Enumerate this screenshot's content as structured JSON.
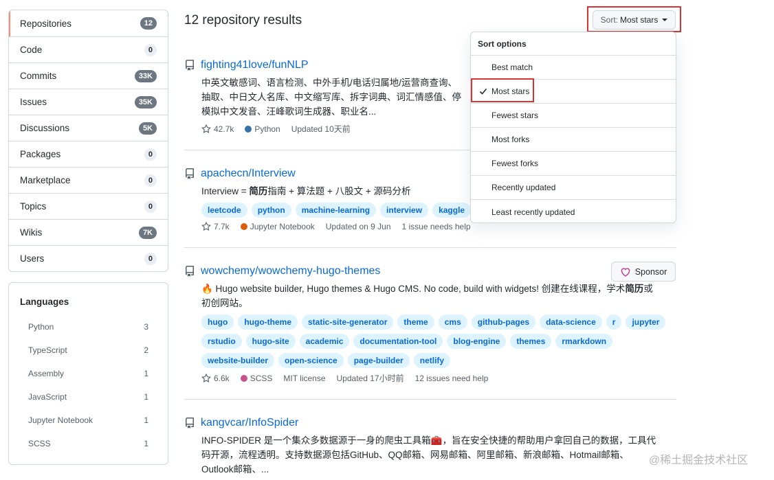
{
  "filters": [
    {
      "label": "Repositories",
      "count": "12",
      "selected": true
    },
    {
      "label": "Code",
      "count": "0"
    },
    {
      "label": "Commits",
      "count": "33K"
    },
    {
      "label": "Issues",
      "count": "35K"
    },
    {
      "label": "Discussions",
      "count": "5K"
    },
    {
      "label": "Packages",
      "count": "0"
    },
    {
      "label": "Marketplace",
      "count": "0"
    },
    {
      "label": "Topics",
      "count": "0"
    },
    {
      "label": "Wikis",
      "count": "7K"
    },
    {
      "label": "Users",
      "count": "0"
    }
  ],
  "languages": {
    "title": "Languages",
    "items": [
      {
        "name": "Python",
        "count": "3"
      },
      {
        "name": "TypeScript",
        "count": "2"
      },
      {
        "name": "Assembly",
        "count": "1"
      },
      {
        "name": "JavaScript",
        "count": "1"
      },
      {
        "name": "Jupyter Notebook",
        "count": "1"
      },
      {
        "name": "SCSS",
        "count": "1"
      }
    ]
  },
  "header": {
    "results_title": "12 repository results",
    "sort_prefix": "Sort: ",
    "sort_value": "Most stars"
  },
  "sort_menu": {
    "title": "Sort options",
    "options": [
      "Best match",
      "Most stars",
      "Fewest stars",
      "Most forks",
      "Fewest forks",
      "Recently updated",
      "Least recently updated"
    ],
    "selected_index": 1
  },
  "repos": [
    {
      "name": "fighting41love/funNLP",
      "desc_lines": [
        "中英文敏感词、语言检测、中外手机/电话归属地/运营商查询、",
        "抽取、中日文人名库、中文缩写库、拆字词典、词汇情感值、停",
        "模拟中文发音、汪峰歌词生成器、职业名..."
      ],
      "stars": "42.7k",
      "language": "Python",
      "language_color": "#3572A5",
      "updated": "Updated 10天前"
    },
    {
      "name": "apachecn/Interview",
      "desc_pre": "Interview = ",
      "desc_bold": "简历",
      "desc_post": "指南 + 算法题 + 八股文 + 源码分析",
      "topics": [
        "leetcode",
        "python",
        "machine-learning",
        "interview",
        "kaggle"
      ],
      "stars": "7.7k",
      "language": "Jupyter Notebook",
      "language_color": "#DA5B0B",
      "updated": "Updated on 9 Jun",
      "issues": "1 issue needs help"
    },
    {
      "name": "wowchemy/wowchemy-hugo-themes",
      "desc_pre": "🔥 Hugo website builder, Hugo themes & Hugo CMS. No code, build with widgets! 创建在线课程，学术",
      "desc_bold": "简历",
      "desc_post": "或",
      "desc_line2": "初创网站。",
      "sponsor_label": "Sponsor",
      "topics": [
        "hugo",
        "hugo-theme",
        "static-site-generator",
        "theme",
        "cms",
        "github-pages",
        "data-science",
        "r",
        "jupyter",
        "rstudio",
        "hugo-site",
        "academic",
        "documentation-tool",
        "blog-engine",
        "themes",
        "rmarkdown",
        "website-builder",
        "open-science",
        "page-builder",
        "netlify"
      ],
      "stars": "6.6k",
      "language": "SCSS",
      "language_color": "#C6538C",
      "license": "MIT license",
      "updated": "Updated 17小时前",
      "issues": "12 issues need help"
    },
    {
      "name": "kangvcar/InfoSpider",
      "desc_lines": [
        "INFO-SPIDER 是一个集众多数据源于一身的爬虫工具箱🧰，旨在安全快捷的帮助用户拿回自己的数据，工具代",
        "码开源，流程透明。支持数据源包括GitHub、QQ邮箱、网易邮箱、阿里邮箱、新浪邮箱、Hotmail邮箱、",
        "Outlook邮箱、..."
      ]
    }
  ],
  "watermark": "@稀土掘金技术社区"
}
